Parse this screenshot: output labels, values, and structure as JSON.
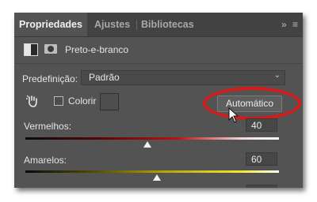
{
  "tabs": [
    {
      "label": "Propriedades",
      "active": true
    },
    {
      "label": "Ajustes",
      "active": false
    },
    {
      "label": "Bibliotecas",
      "active": false
    }
  ],
  "tabbar_icons": {
    "collapse": "»",
    "menu": "≡"
  },
  "adjustment": {
    "title": "Preto-e-branco",
    "icon": "black-white-adjustment-icon"
  },
  "preset": {
    "label": "Predefinição:",
    "value": "Padrão"
  },
  "tools": {
    "colorize_label": "Colorir",
    "colorize_checked": false,
    "auto_label": "Automático"
  },
  "sliders": {
    "reds": {
      "label": "Vermelhos:",
      "value": "40",
      "level": 40,
      "min": -200,
      "max": 300
    },
    "yellows": {
      "label": "Amarelos:",
      "value": "60",
      "level": 60,
      "min": -200,
      "max": 300
    }
  },
  "colors": {
    "highlight": "#d61a1a",
    "panel": "#535353"
  }
}
